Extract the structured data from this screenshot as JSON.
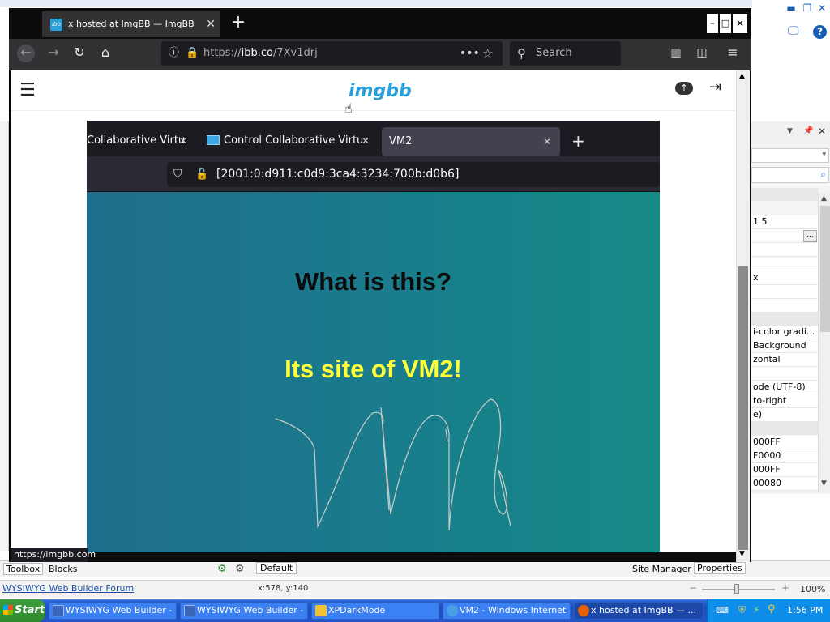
{
  "firefox": {
    "tab_title": "x hosted at ImgBB — ImgBB",
    "url_prefix": "https://",
    "url_domain": "ibb.co",
    "url_path": "/7Xv1drj",
    "search_placeholder": "Search",
    "status_tooltip": "https://imgbb.com"
  },
  "imgbb": {
    "logo": "imgbb"
  },
  "embedded_browser": {
    "tabs": [
      {
        "label": "Collaborative Virtu"
      },
      {
        "label": "Control Collaborative Virtu"
      },
      {
        "label": "VM2"
      }
    ],
    "url": "[2001:0:d911:c0d9:3ca4:3234:700b:d0b6]",
    "heading": "What is this?",
    "subheading": "Its site of VM2!"
  },
  "wysiwyg": {
    "properties": [
      "1 5",
      "x",
      "i-color gradi...",
      "Background",
      "zontal",
      "ode (UTF-8)",
      "to-right",
      "e)",
      "000FF",
      "F0000",
      "000FF",
      "00080"
    ],
    "ellipsis": "...",
    "bottom_tabs": [
      "Toolbox",
      "Blocks",
      "Default",
      "Site Manager",
      "Properties"
    ],
    "status_link": "WYSIWYG Web Builder Forum",
    "coords": "x:578, y:140",
    "zoom": "100%"
  },
  "taskbar": {
    "start": "Start",
    "tasks": [
      "WYSIWYG Web Builder - ...",
      "WYSIWYG Web Builder - ...",
      "XPDarkMode",
      "VM2 - Windows Internet ...",
      "x hosted at ImgBB — ..."
    ],
    "clock": "1:56 PM"
  }
}
